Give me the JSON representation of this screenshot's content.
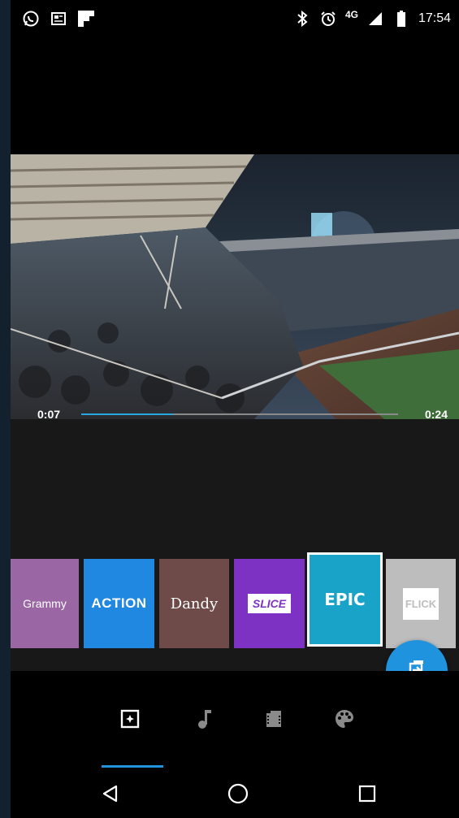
{
  "status_bar": {
    "left_icons": [
      "whatsapp-icon",
      "news-icon",
      "flipboard-icon"
    ],
    "right_icons": [
      "bluetooth-icon",
      "alarm-icon",
      "signal-icon",
      "battery-icon"
    ],
    "network": "4G",
    "time": "17:54"
  },
  "player": {
    "current_time": "0:07",
    "duration": "0:24",
    "progress": 0.29
  },
  "themes": [
    {
      "label": "Grammy",
      "color": "#9a66a3"
    },
    {
      "label": "ACTION",
      "color": "#2188e2"
    },
    {
      "label": "Dandy",
      "color": "#6e4b49"
    },
    {
      "label": "SLICE",
      "color": "#7d32c4"
    },
    {
      "label": "EPIC",
      "color": "#19a3c8",
      "selected": true
    },
    {
      "label": "FLICK",
      "color": "#bdbdbd"
    }
  ],
  "fab": {
    "icon": "export-icon",
    "color": "#1f93dd"
  },
  "bottom_tabs": [
    {
      "icon": "style-icon",
      "active": true
    },
    {
      "icon": "music-icon",
      "active": false
    },
    {
      "icon": "film-icon",
      "active": false
    },
    {
      "icon": "palette-icon",
      "active": false
    }
  ],
  "nav_bar": [
    "back-icon",
    "home-icon",
    "recents-icon"
  ],
  "accent_color": "#1f93dd"
}
